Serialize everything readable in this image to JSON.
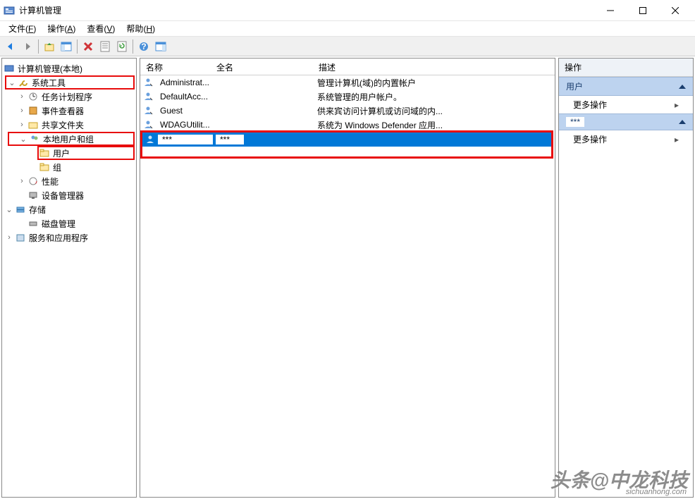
{
  "window": {
    "title": "计算机管理"
  },
  "menubar": {
    "file": "文件",
    "file_key": "F",
    "action": "操作",
    "action_key": "A",
    "view": "查看",
    "view_key": "V",
    "help": "帮助",
    "help_key": "H"
  },
  "tree": {
    "root": "计算机管理(本地)",
    "system_tools": "系统工具",
    "task_scheduler": "任务计划程序",
    "event_viewer": "事件查看器",
    "shared_folders": "共享文件夹",
    "local_users_groups": "本地用户和组",
    "users": "用户",
    "groups": "组",
    "performance": "性能",
    "device_manager": "设备管理器",
    "storage": "存储",
    "disk_management": "磁盘管理",
    "services_apps": "服务和应用程序"
  },
  "list": {
    "columns": {
      "name": "名称",
      "fullname": "全名",
      "desc": "描述"
    },
    "rows": [
      {
        "name": "Administrat...",
        "fullname": "",
        "desc": "管理计算机(域)的内置帐户"
      },
      {
        "name": "DefaultAcc...",
        "fullname": "",
        "desc": "系统管理的用户帐户。"
      },
      {
        "name": "Guest",
        "fullname": "",
        "desc": "供来宾访问计算机或访问域的内..."
      },
      {
        "name": "WDAGUtilit...",
        "fullname": "",
        "desc": "系统为 Windows Defender 应用..."
      }
    ],
    "selected": {
      "name": "***",
      "fullname": "***",
      "desc": ""
    }
  },
  "actions": {
    "header": "操作",
    "section1": "用户",
    "more": "更多操作",
    "section2": "***"
  },
  "watermark": {
    "main": "头条@中龙科技",
    "sub": "sichuanhong.com"
  }
}
